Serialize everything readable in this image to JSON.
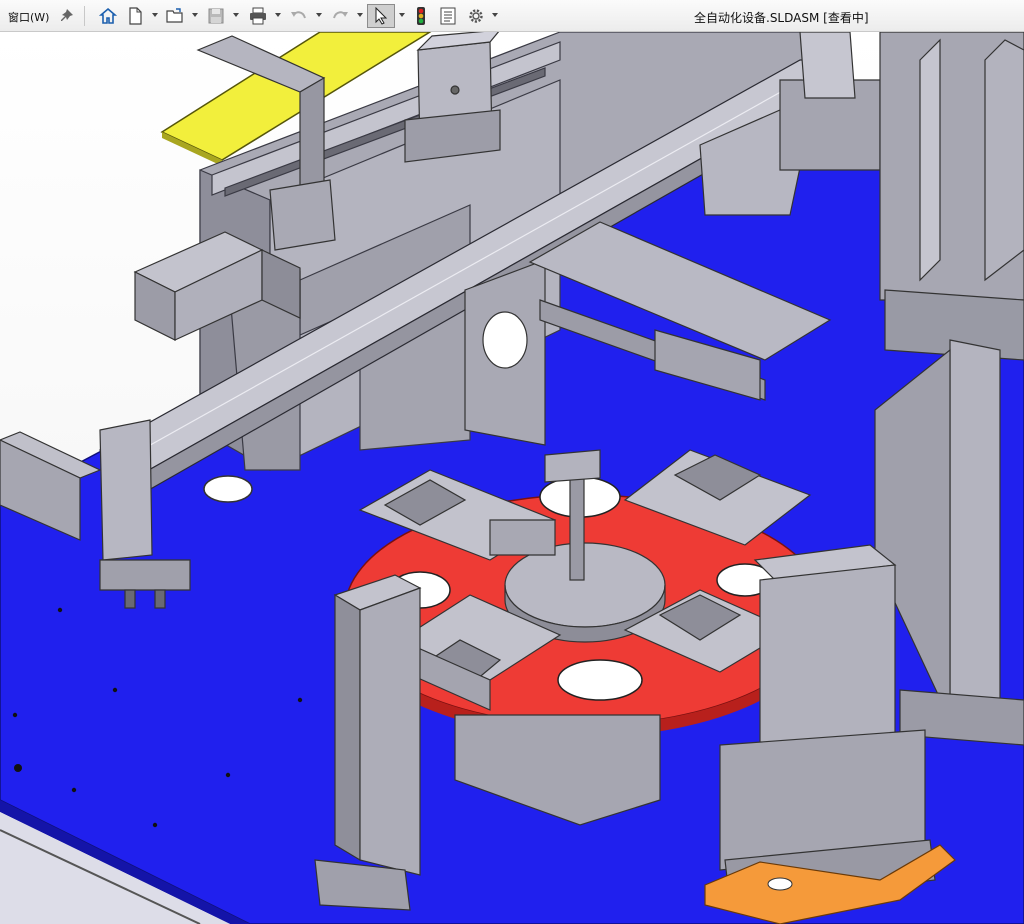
{
  "toolbar": {
    "menu_window": "窗口(W)",
    "items": [
      "pin",
      "home",
      "new",
      "open",
      "save",
      "print",
      "undo",
      "redo",
      "select",
      "rebuild",
      "file-properties",
      "options"
    ]
  },
  "window": {
    "title": "全自动化设备.SLDASM [查看中]"
  },
  "colors": {
    "base_plate": "#2020ee",
    "rotary_table": "#ee3b35",
    "steel": "#a9a9b4",
    "cover": "#f2ef3c",
    "pad": "#f59a3a"
  }
}
